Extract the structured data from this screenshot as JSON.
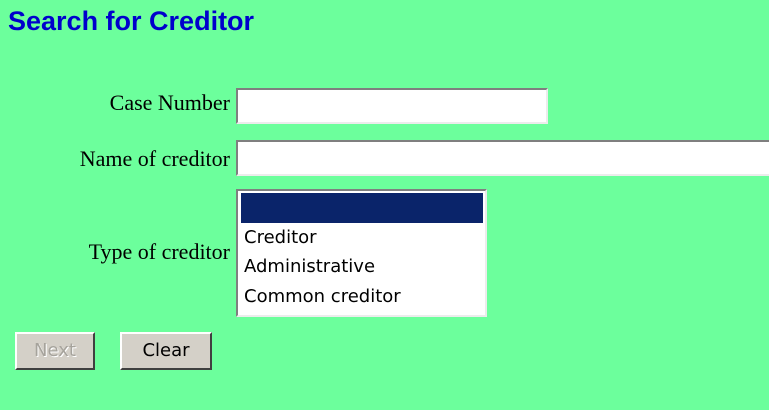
{
  "page": {
    "title": "Search for Creditor",
    "background_color": "#6cff9c",
    "title_color": "#0000cc"
  },
  "form": {
    "case_number": {
      "label": "Case Number",
      "value": ""
    },
    "creditor_name": {
      "label": "Name of creditor",
      "value": ""
    },
    "creditor_type": {
      "label": "Type of creditor",
      "selected_index": 0,
      "options": [
        "",
        "Creditor",
        "Administrative",
        "Common creditor"
      ]
    }
  },
  "buttons": {
    "next_label": "Next",
    "next_disabled": true,
    "clear_label": "Clear"
  }
}
